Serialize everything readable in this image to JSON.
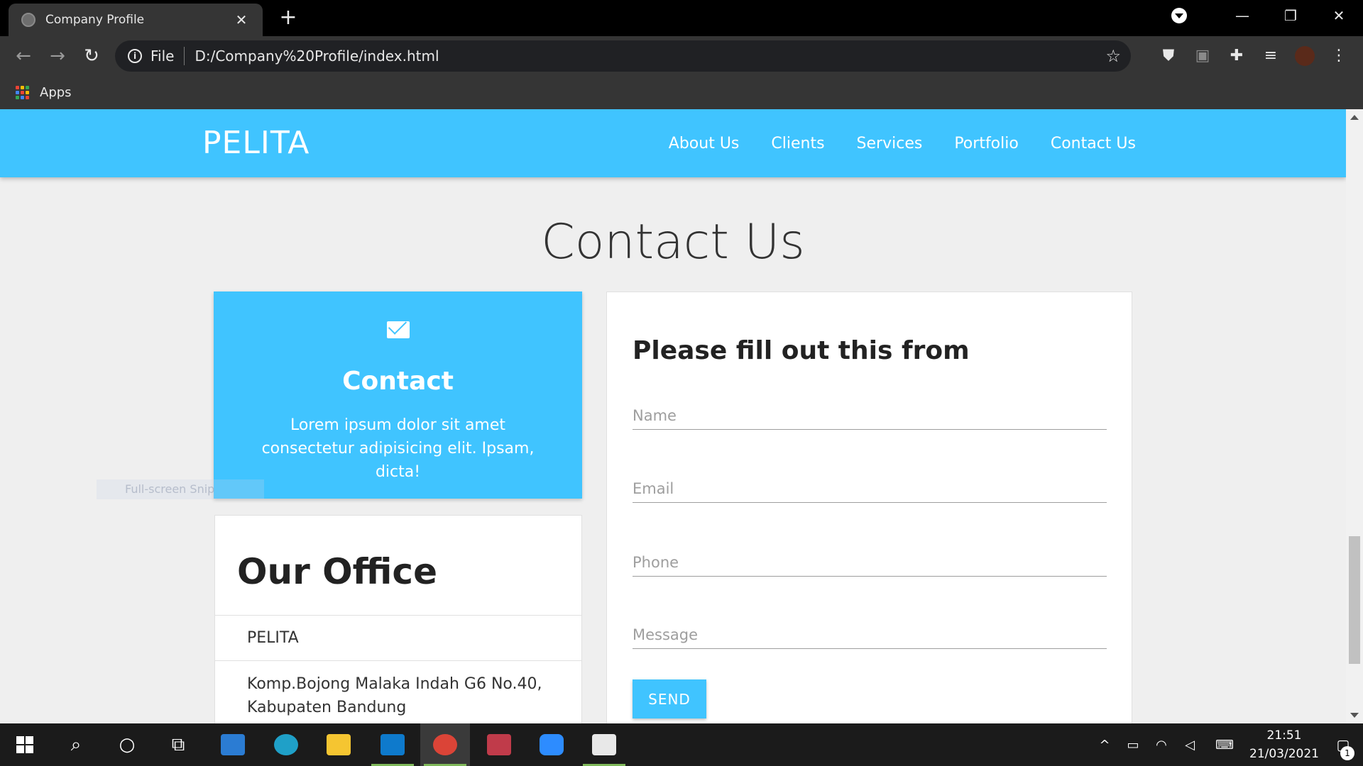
{
  "browser": {
    "tab_title": "Company Profile",
    "tab_close": "✕",
    "new_tab": "+",
    "omnibox": {
      "scheme_label": "File",
      "url": "D:/Company%20Profile/index.html"
    },
    "bookmarks": {
      "apps_label": "Apps"
    },
    "window_controls": {
      "minimize": "—",
      "restore": "❐",
      "close": "✕"
    }
  },
  "site": {
    "brand": "PELITA",
    "nav": [
      "About Us",
      "Clients",
      "Services",
      "Portfolio",
      "Contact Us"
    ],
    "colors": {
      "primary": "#40c4ff",
      "background": "#efefef"
    }
  },
  "contact_section": {
    "title": "Contact Us",
    "contact_card": {
      "heading": "Contact",
      "text": "Lorem ipsum dolor sit amet consectetur adipisicing elit. Ipsam, dicta!",
      "icon": "mail-icon"
    },
    "office": {
      "heading": "Our Office",
      "name": "PELITA",
      "address": "Komp.Bojong Malaka Indah G6 No.40, Kabupaten Bandung"
    },
    "form": {
      "heading": "Please fill out this from",
      "name_placeholder": "Name",
      "email_placeholder": "Email",
      "phone_placeholder": "Phone",
      "message_placeholder": "Message",
      "send_label": "SEND"
    }
  },
  "overlay": {
    "snip_text": "Full-screen Snip"
  },
  "taskbar": {
    "clock_time": "21:51",
    "clock_date": "21/03/2021",
    "notification_count": "1"
  }
}
